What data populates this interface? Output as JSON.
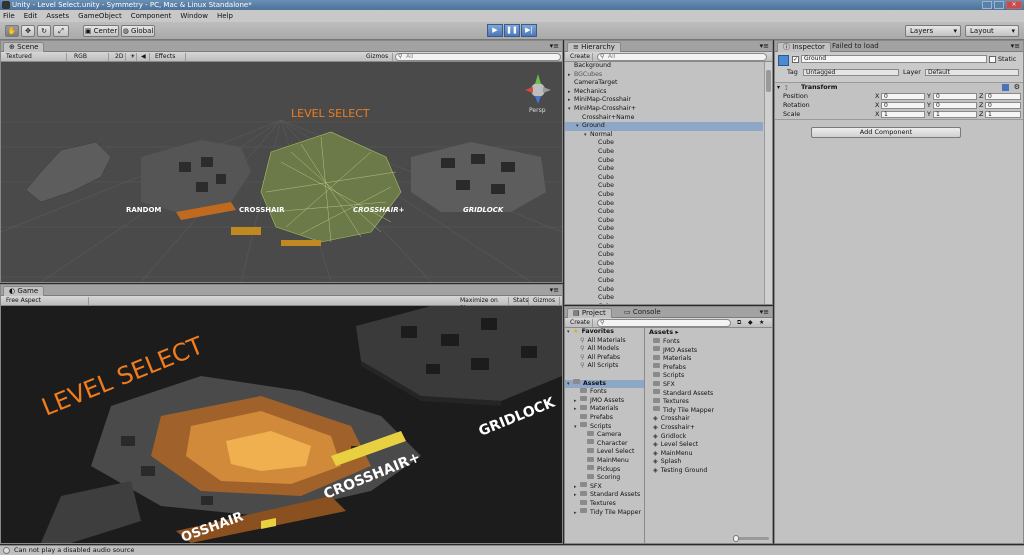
{
  "window": {
    "title": "Unity - Level Select.unity - Symmetry - PC, Mac & Linux Standalone*"
  },
  "menu": [
    "File",
    "Edit",
    "Assets",
    "GameObject",
    "Component",
    "Window",
    "Help"
  ],
  "toolbar": {
    "center_label": "Center",
    "global_label": "Global",
    "layers_label": "Layers",
    "layout_label": "Layout"
  },
  "scene": {
    "tab_label": "Scene",
    "shading": "Textured",
    "render": "RGB",
    "mode_2d": "2D",
    "effects": "Effects",
    "gizmos": "Gizmos",
    "search_placeholder": "All",
    "persp_label": "Persp",
    "labels": {
      "level_select": "LEVEL SELECT",
      "random": "RANDOM",
      "crosshair": "CROSSHAIR",
      "crosshair_plus": "CROSSHAIR+",
      "gridlock": "GRIDLOCK"
    },
    "accent_orange": "#f07c1c"
  },
  "game": {
    "tab_label": "Game",
    "aspect": "Free Aspect",
    "maximize": "Maximize on Play",
    "stats": "Stats",
    "gizmos": "Gizmos",
    "labels": {
      "level_select": "LEVEL SELECT",
      "gridlock": "GRIDLOCK",
      "crosshair_plus": "CROSSHAIR+",
      "crosshair": "OSSHAIR"
    }
  },
  "hierarchy": {
    "tab_label": "Hierarchy",
    "create": "Create",
    "search_placeholder": "All",
    "items": [
      {
        "label": "Background",
        "indent": 0,
        "arrow": ""
      },
      {
        "label": "BGCubes",
        "indent": 0,
        "arrow": "▸",
        "dim": true
      },
      {
        "label": "CameraTarget",
        "indent": 0,
        "arrow": ""
      },
      {
        "label": "Mechanics",
        "indent": 0,
        "arrow": "▸"
      },
      {
        "label": "MiniMap-Crosshair",
        "indent": 0,
        "arrow": "▸"
      },
      {
        "label": "MiniMap-Crosshair+",
        "indent": 0,
        "arrow": "▾"
      },
      {
        "label": "Crosshair+Name",
        "indent": 1,
        "arrow": ""
      },
      {
        "label": "Ground",
        "indent": 1,
        "arrow": "▾",
        "selected": true
      },
      {
        "label": "Normal",
        "indent": 2,
        "arrow": "▾"
      },
      {
        "label": "Cube",
        "indent": 3,
        "arrow": ""
      },
      {
        "label": "Cube",
        "indent": 3,
        "arrow": ""
      },
      {
        "label": "Cube",
        "indent": 3,
        "arrow": ""
      },
      {
        "label": "Cube",
        "indent": 3,
        "arrow": ""
      },
      {
        "label": "Cube",
        "indent": 3,
        "arrow": ""
      },
      {
        "label": "Cube",
        "indent": 3,
        "arrow": ""
      },
      {
        "label": "Cube",
        "indent": 3,
        "arrow": ""
      },
      {
        "label": "Cube",
        "indent": 3,
        "arrow": ""
      },
      {
        "label": "Cube",
        "indent": 3,
        "arrow": ""
      },
      {
        "label": "Cube",
        "indent": 3,
        "arrow": ""
      },
      {
        "label": "Cube",
        "indent": 3,
        "arrow": ""
      },
      {
        "label": "Cube",
        "indent": 3,
        "arrow": ""
      },
      {
        "label": "Cube",
        "indent": 3,
        "arrow": ""
      },
      {
        "label": "Cube",
        "indent": 3,
        "arrow": ""
      },
      {
        "label": "Cube",
        "indent": 3,
        "arrow": ""
      },
      {
        "label": "Cube",
        "indent": 3,
        "arrow": ""
      },
      {
        "label": "Cube",
        "indent": 3,
        "arrow": ""
      },
      {
        "label": "Cube",
        "indent": 3,
        "arrow": ""
      },
      {
        "label": "Cube",
        "indent": 3,
        "arrow": ""
      },
      {
        "label": "Cube",
        "indent": 3,
        "arrow": ""
      },
      {
        "label": "Cube",
        "indent": 3,
        "arrow": ""
      }
    ]
  },
  "project": {
    "tab_label": "Project",
    "console_tab": "Console",
    "create": "Create",
    "tree": [
      {
        "label": "Favorites",
        "indent": 0,
        "bold": true,
        "arrow": "▾",
        "icon": "star"
      },
      {
        "label": "All Materials",
        "indent": 1,
        "icon": "search"
      },
      {
        "label": "All Models",
        "indent": 1,
        "icon": "search"
      },
      {
        "label": "All Prefabs",
        "indent": 1,
        "icon": "search"
      },
      {
        "label": "All Scripts",
        "indent": 1,
        "icon": "search"
      },
      {
        "label": "",
        "indent": 0,
        "icon": ""
      },
      {
        "label": "Assets",
        "indent": 0,
        "bold": true,
        "arrow": "▾",
        "icon": "folder",
        "selected": true
      },
      {
        "label": "Fonts",
        "indent": 1,
        "icon": "folder"
      },
      {
        "label": "JMO Assets",
        "indent": 1,
        "arrow": "▸",
        "icon": "folder"
      },
      {
        "label": "Materials",
        "indent": 1,
        "arrow": "▸",
        "icon": "folder"
      },
      {
        "label": "Prefabs",
        "indent": 1,
        "icon": "folder"
      },
      {
        "label": "Scripts",
        "indent": 1,
        "arrow": "▾",
        "icon": "folder"
      },
      {
        "label": "Camera",
        "indent": 2,
        "icon": "folder"
      },
      {
        "label": "Character",
        "indent": 2,
        "icon": "folder"
      },
      {
        "label": "Level Select",
        "indent": 2,
        "icon": "folder"
      },
      {
        "label": "MainMenu",
        "indent": 2,
        "icon": "folder"
      },
      {
        "label": "Pickups",
        "indent": 2,
        "icon": "folder"
      },
      {
        "label": "Scoring",
        "indent": 2,
        "icon": "folder"
      },
      {
        "label": "SFX",
        "indent": 1,
        "arrow": "▸",
        "icon": "folder"
      },
      {
        "label": "Standard Assets",
        "indent": 1,
        "arrow": "▸",
        "icon": "folder"
      },
      {
        "label": "Textures",
        "indent": 1,
        "icon": "folder"
      },
      {
        "label": "Tidy Tile Mapper",
        "indent": 1,
        "arrow": "▸",
        "icon": "folder"
      }
    ],
    "assets_header": "Assets",
    "assets": [
      {
        "label": "Fonts",
        "icon": "folder"
      },
      {
        "label": "JMO Assets",
        "icon": "folder"
      },
      {
        "label": "Materials",
        "icon": "folder"
      },
      {
        "label": "Prefabs",
        "icon": "folder"
      },
      {
        "label": "Scripts",
        "icon": "folder"
      },
      {
        "label": "SFX",
        "icon": "folder"
      },
      {
        "label": "Standard Assets",
        "icon": "folder"
      },
      {
        "label": "Textures",
        "icon": "folder"
      },
      {
        "label": "Tidy Tile Mapper",
        "icon": "folder"
      },
      {
        "label": "Crosshair",
        "icon": "unity"
      },
      {
        "label": "Crosshair+",
        "icon": "unity"
      },
      {
        "label": "Gridlock",
        "icon": "unity"
      },
      {
        "label": "Level Select",
        "icon": "unity"
      },
      {
        "label": "MainMenu",
        "icon": "unity"
      },
      {
        "label": "Splash",
        "icon": "unity"
      },
      {
        "label": "Testing Ground",
        "icon": "unity"
      }
    ]
  },
  "inspector": {
    "tab_label": "Inspector",
    "failed_tab": "Failed to load",
    "object_name": "Ground",
    "static_label": "Static",
    "tag_label": "Tag",
    "tag_value": "Untagged",
    "layer_label": "Layer",
    "layer_value": "Default",
    "transform_label": "Transform",
    "position_label": "Position",
    "rotation_label": "Rotation",
    "scale_label": "Scale",
    "position": {
      "x": "0",
      "y": "0",
      "z": "0"
    },
    "rotation": {
      "x": "0",
      "y": "0",
      "z": "0"
    },
    "scale": {
      "x": "1",
      "y": "1",
      "z": "1"
    },
    "add_component": "Add Component"
  },
  "status": {
    "message": "Can not play a disabled audio source"
  }
}
